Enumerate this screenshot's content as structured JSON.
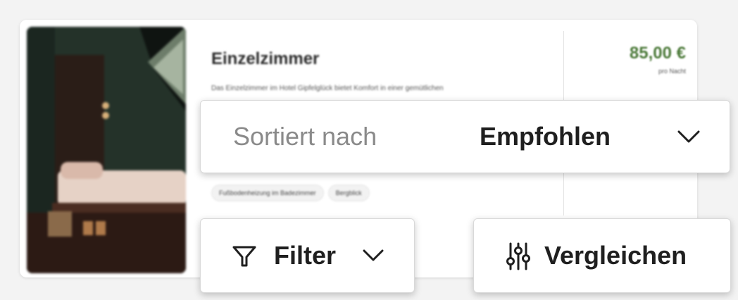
{
  "room_card": {
    "title": "Einzelzimmer",
    "description": "Das Einzelzimmer im Hotel Gipfelglück bietet Komfort in einer gemütlichen",
    "tags": [
      "Fußbodenheizung im Badezimmer",
      "Bergblick"
    ],
    "price": "85,00 €",
    "price_unit": "pro Nacht"
  },
  "sort": {
    "label": "Sortiert nach",
    "value": "Empfohlen",
    "icon": "chevron-down-icon"
  },
  "filter": {
    "label": "Filter",
    "icon": "filter-icon",
    "chevron": "chevron-down-icon"
  },
  "compare": {
    "label": "Vergleichen",
    "icon": "sliders-icon"
  },
  "colors": {
    "price": "#4c7a3a",
    "text_dark": "#1f1f1f",
    "text_muted": "#8a8a8a"
  }
}
